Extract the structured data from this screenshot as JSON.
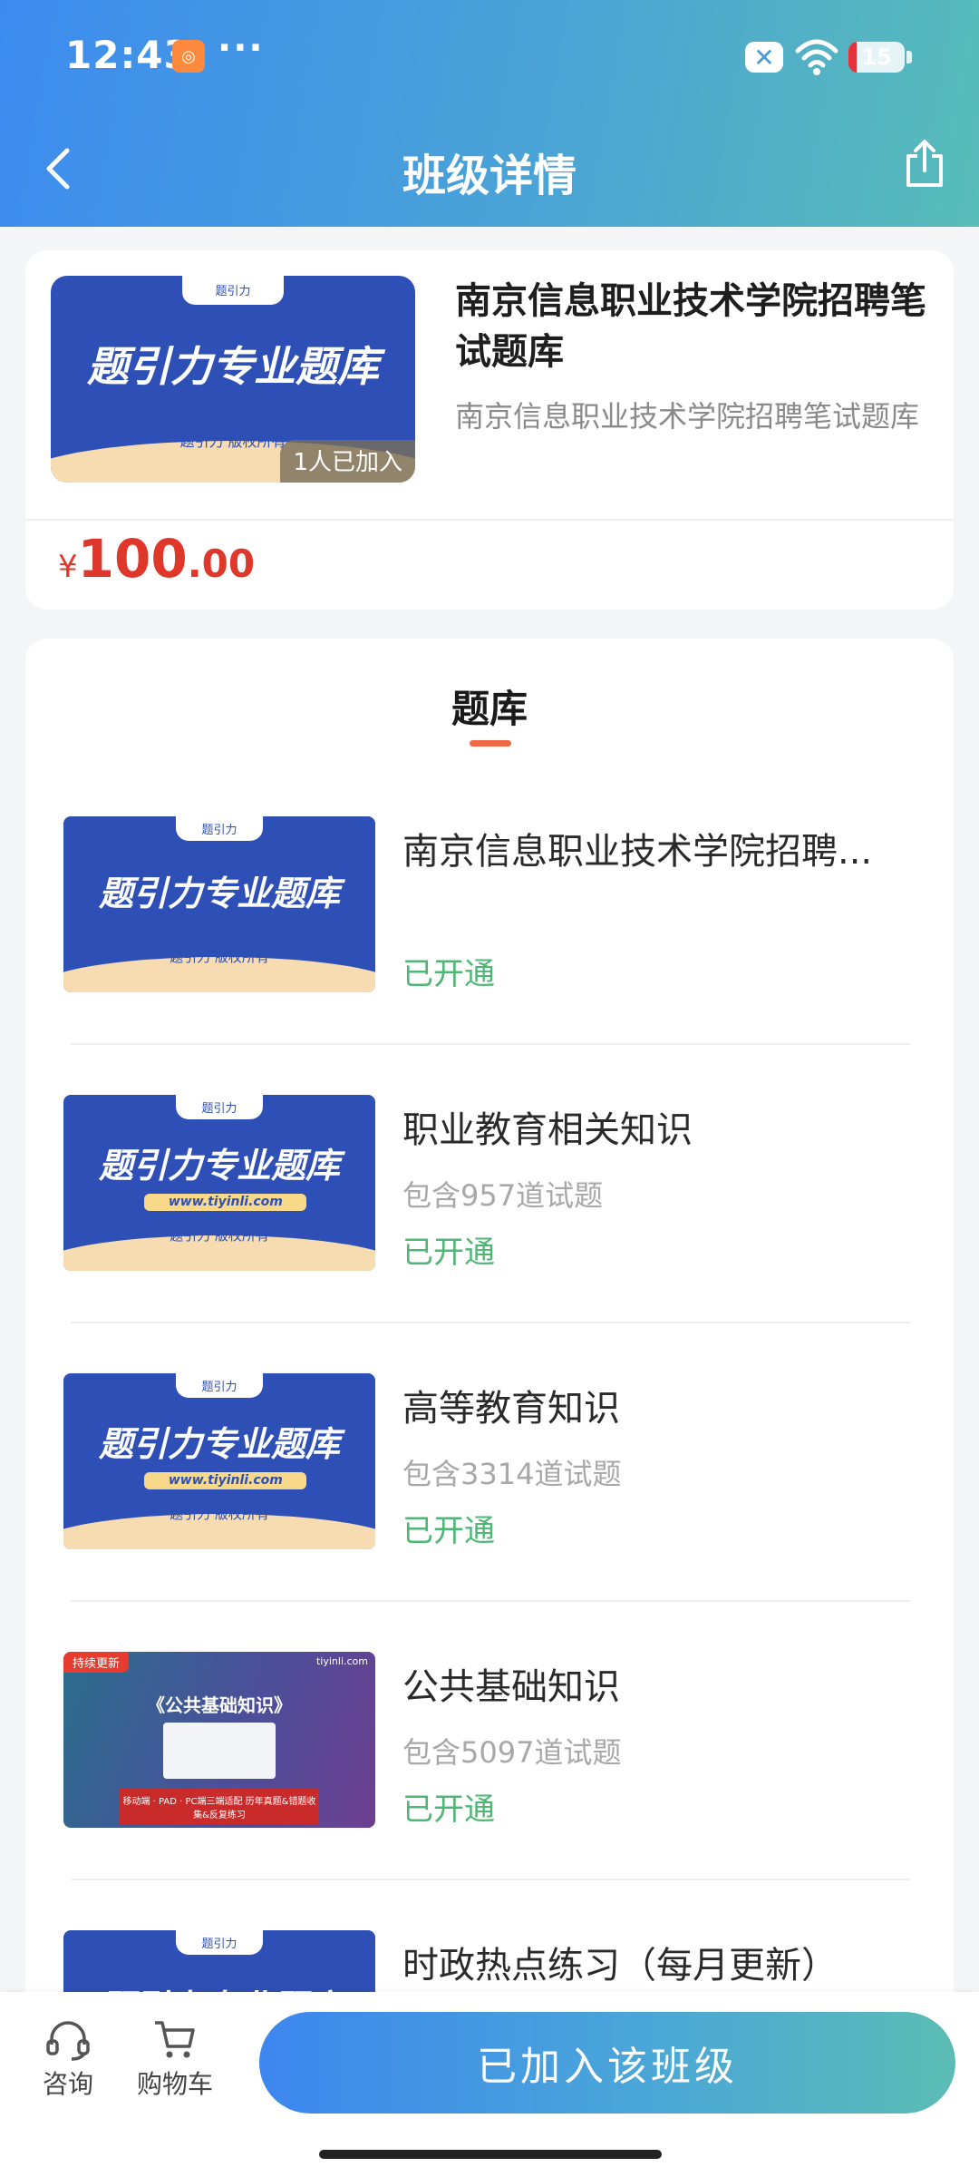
{
  "status_bar": {
    "time": "12:43",
    "app_badge": "◎",
    "more": "···",
    "battery_percent": 15,
    "battery_label": "15",
    "icons": [
      "app-notification-icon",
      "close-x-icon",
      "wifi-icon",
      "battery-icon"
    ]
  },
  "nav": {
    "title": "班级详情",
    "back_icon": "chevron-left-icon",
    "share_icon": "share-icon"
  },
  "course": {
    "cover_headline": "题引力专业题库",
    "cover_brand": "题引力",
    "cover_sub": "题引力  版权所有",
    "members": "1人已加入",
    "title": "南京信息职业技术学院招聘笔试题库",
    "description": "南京信息职业技术学院招聘笔试题库",
    "price_symbol": "¥",
    "price_int": "100",
    "price_dec": ".00"
  },
  "bank": {
    "section_title": "题库",
    "items": [
      {
        "title": "南京信息职业技术学院招聘...",
        "count": "",
        "status": "已开通",
        "cover": "blue",
        "cover_url": "",
        "cover_headline": "题引力专业题库",
        "cover_sub": "题引力  版权所有",
        "cover_brand": "题引力"
      },
      {
        "title": "职业教育相关知识",
        "count": "包含957道试题",
        "status": "已开通",
        "cover": "blue",
        "cover_url": "www.tiyinli.com",
        "cover_headline": "题引力专业题库",
        "cover_sub": "题引力  版权所有",
        "cover_brand": "题引力"
      },
      {
        "title": "高等教育知识",
        "count": "包含3314道试题",
        "status": "已开通",
        "cover": "blue",
        "cover_url": "www.tiyinli.com",
        "cover_headline": "题引力专业题库",
        "cover_sub": "题引力  版权所有",
        "cover_brand": "题引力"
      },
      {
        "title": "公共基础知识",
        "count": "包含5097道试题",
        "status": "已开通",
        "cover": "purple",
        "cover_tag": "持续更新",
        "cover_title": "《公共基础知识》",
        "cover_banner": "移动端 · PAD · PC端三端适配 历年真题&错题收集&反复练习",
        "cover_logo": "tiyinli.com"
      },
      {
        "title": "时政热点练习（每月更新）",
        "count": "",
        "status": "",
        "cover": "blue",
        "cover_url": "",
        "cover_headline": "题引力专业题库",
        "cover_sub": "",
        "cover_brand": "题引力"
      }
    ]
  },
  "bottom_bar": {
    "consult_label": "咨询",
    "cart_label": "购物车",
    "join_label": "已加入该班级",
    "consult_icon": "headset-icon",
    "cart_icon": "cart-icon"
  },
  "colors": {
    "header_gradient": [
      "#3d8bf0",
      "#58bcb8"
    ],
    "price": "#e0372b",
    "status_green": "#4fb775",
    "underline": "#ee6a45"
  }
}
